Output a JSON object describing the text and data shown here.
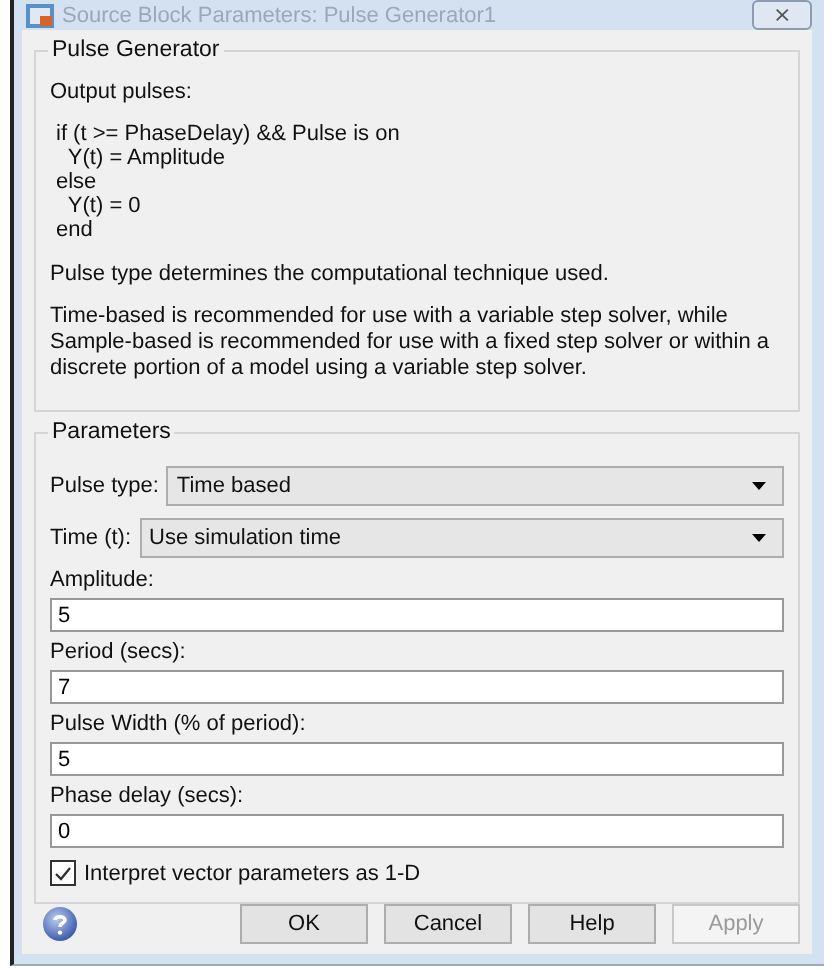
{
  "window": {
    "title": "Source Block Parameters: Pulse Generator1",
    "close": "⨯"
  },
  "description": {
    "title": "Pulse Generator",
    "intro": "Output pulses:",
    "code": [
      "if (t >= PhaseDelay) && Pulse is on",
      "  Y(t) = Amplitude",
      "else",
      "  Y(t) = 0",
      "end"
    ],
    "paragraphs": [
      "Pulse type determines the computational technique used.",
      "Time-based is recommended for use with a variable step solver, while Sample-based is recommended for use with a fixed step solver or within a discrete portion of a model using a variable step solver."
    ]
  },
  "parameters": {
    "title": "Parameters",
    "fields": [
      {
        "kind": "dropdown",
        "label": "Pulse type:",
        "value": "Time based"
      },
      {
        "kind": "dropdown",
        "label": "Time (t):",
        "value": "Use simulation time"
      },
      {
        "kind": "text",
        "label": "Amplitude:",
        "value": "5"
      },
      {
        "kind": "text",
        "label": "Period (secs):",
        "value": "7"
      },
      {
        "kind": "text",
        "label": "Pulse Width (% of period):",
        "value": "5"
      },
      {
        "kind": "text",
        "label": "Phase delay (secs):",
        "value": "0"
      }
    ],
    "checkbox": {
      "label": "Interpret vector parameters as 1-D",
      "checked": true
    }
  },
  "buttons": [
    {
      "label": "OK",
      "disabled": false
    },
    {
      "label": "Cancel",
      "disabled": false
    },
    {
      "label": "Help",
      "disabled": false
    },
    {
      "label": "Apply",
      "disabled": true
    }
  ]
}
